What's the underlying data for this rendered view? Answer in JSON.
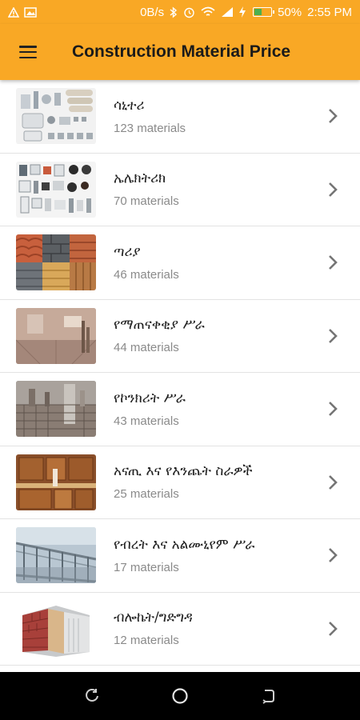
{
  "status_bar": {
    "network_speed": "0B/s",
    "battery_percent": "50%",
    "time": "2:55 PM",
    "battery_level": 0.5
  },
  "app_bar": {
    "title": "Construction Material Price"
  },
  "categories": [
    {
      "title": "ሳኒተሪ",
      "count": "123 materials"
    },
    {
      "title": "ኤሌክትሪክ",
      "count": "70 materials"
    },
    {
      "title": "ጣሪያ",
      "count": "46 materials"
    },
    {
      "title": "የማጠናቀቂያ ሥራ",
      "count": "44 materials"
    },
    {
      "title": "የኮንክሪት ሥራ",
      "count": "43 materials"
    },
    {
      "title": "አናጢ እና የእንጨት ስራዎች",
      "count": "25 materials"
    },
    {
      "title": "የብረት እና አልሙኒየም ሥራ",
      "count": "17 materials"
    },
    {
      "title": "ብሎኬት/ግድግዳ",
      "count": "12 materials"
    }
  ],
  "colors": {
    "accent": "#f9a825",
    "title_text": "#1a1a1a",
    "subtitle_text": "#8a8a8a",
    "nav_background": "#000000"
  },
  "icons": {
    "menu": "hamburger-menu-icon",
    "chevron": "chevron-right-icon",
    "back": "back-icon",
    "home": "home-icon",
    "recents": "recents-icon"
  }
}
